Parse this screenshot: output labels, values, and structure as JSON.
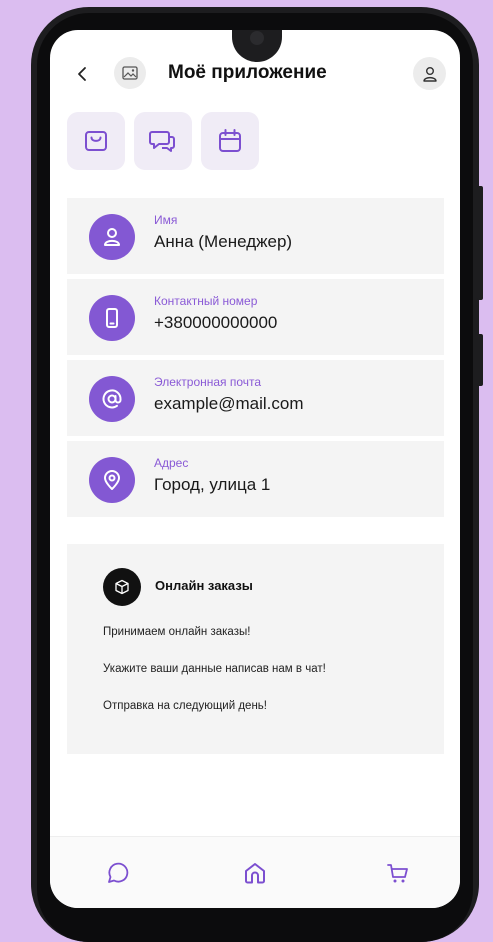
{
  "header": {
    "title": "Моё приложение"
  },
  "quick_actions": [
    {
      "icon": "shopping-bag-icon"
    },
    {
      "icon": "chat-icon"
    },
    {
      "icon": "calendar-icon"
    }
  ],
  "contacts": [
    {
      "icon": "user-icon",
      "label": "Имя",
      "value": "Анна (Менеджер)"
    },
    {
      "icon": "phone-icon",
      "label": "Контактный номер",
      "value": "+380000000000"
    },
    {
      "icon": "at-icon",
      "label": "Электронная почта",
      "value": "example@mail.com"
    },
    {
      "icon": "location-pin-icon",
      "label": "Адрес",
      "value": "Город, улица 1"
    }
  ],
  "orders": {
    "title": "Онлайн заказы",
    "lines": [
      "Принимаем онлайн заказы!",
      "Укажите ваши данные написав нам в чат!",
      "Отправка на следующий день!"
    ]
  },
  "bottom_nav": [
    {
      "icon": "chat-icon"
    },
    {
      "icon": "home-icon",
      "active": true
    },
    {
      "icon": "cart-icon"
    }
  ],
  "colors": {
    "background": "#dbbdf0",
    "accent": "#8358d3",
    "card": "#f4f4f4",
    "label": "#8a5ad6"
  }
}
